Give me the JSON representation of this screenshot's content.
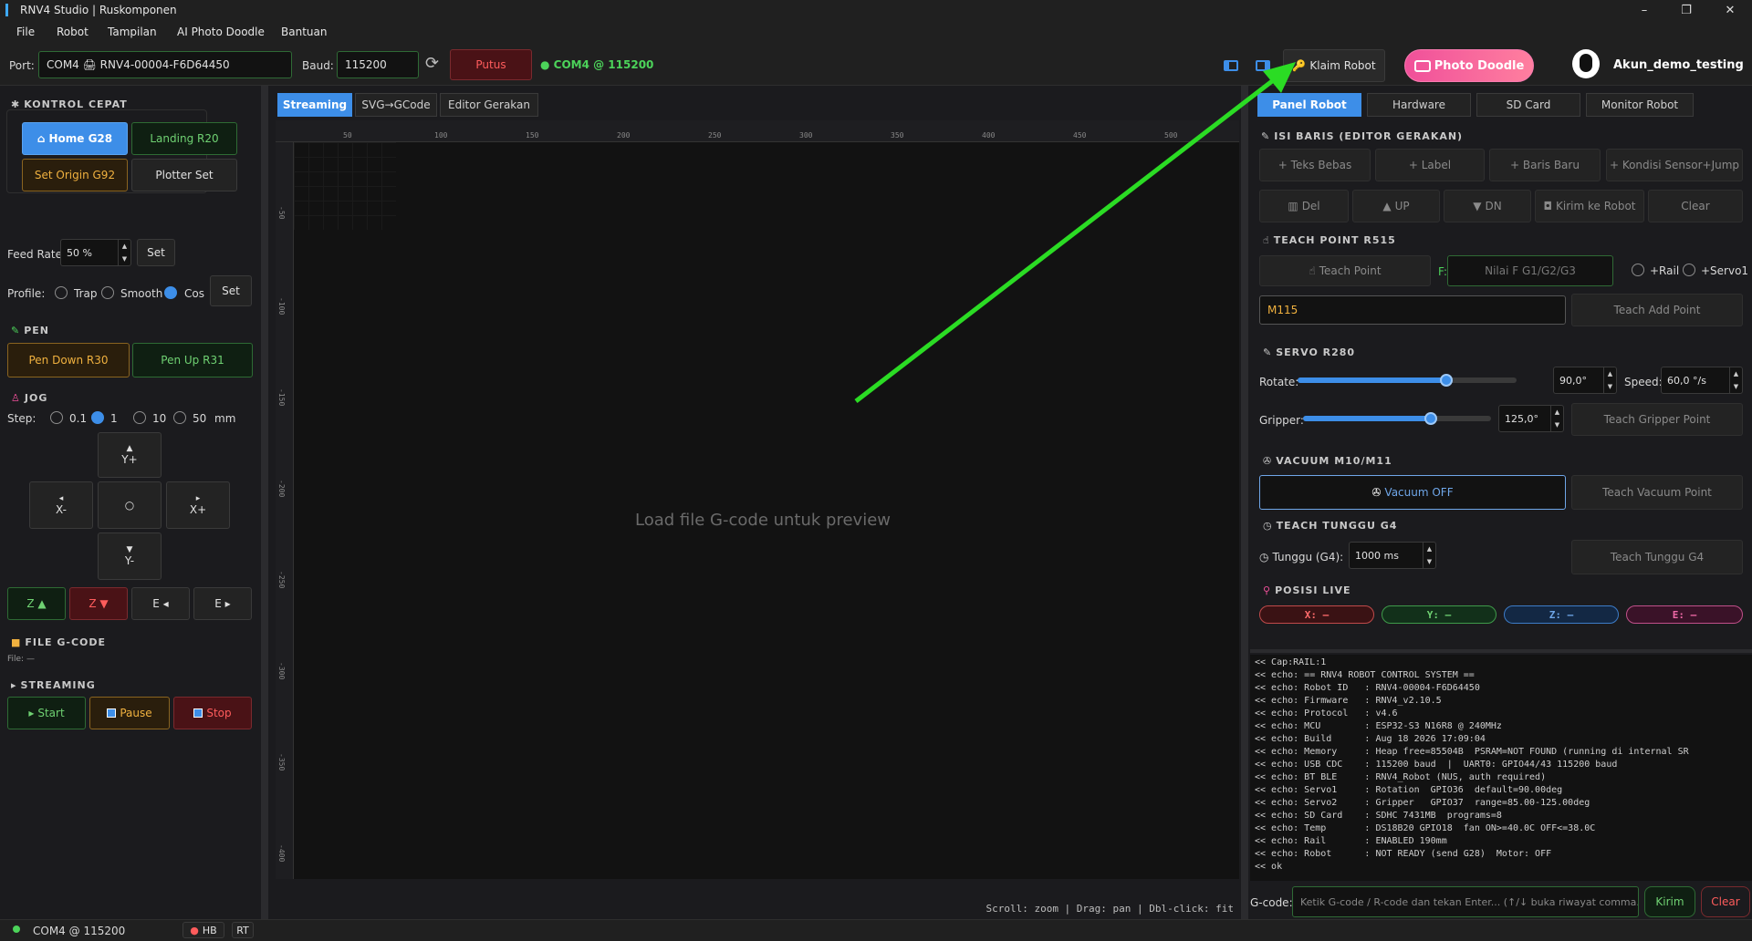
{
  "window": {
    "title": "RNV4 Studio | Ruskomponen",
    "minimize": "–",
    "maximize": "❐",
    "close": "✕"
  },
  "menu": [
    "File",
    "Robot",
    "Tampilan",
    "AI Photo Doodle",
    "Bantuan"
  ],
  "toolbar": {
    "port_label": "Port:",
    "port_value": "COM4 🖨 RNV4-00004-F6D64450",
    "baud_label": "Baud:",
    "baud_value": "115200",
    "disconnect": "Putus",
    "status": "COM4 @ 115200",
    "claim_robot": "Klaim Robot",
    "photo_doodle": "Photo Doodle",
    "account": "Akun_demo_testing"
  },
  "left": {
    "kontrol_title": "KONTROL CEPAT",
    "home": "Home  G28",
    "landing": "Landing  R20",
    "set_origin": "Set Origin  G92",
    "plotter_set": "Plotter Set",
    "feed_label": "Feed Rate:",
    "feed_value": "50 %",
    "set": "Set",
    "profile_label": "Profile:",
    "profiles": [
      "Trap",
      "Smooth",
      "Cos"
    ],
    "profile_selected": "Cos",
    "pen_title": "PEN",
    "pen_down": "Pen Down  R30",
    "pen_up": "Pen Up  R31",
    "jog_title": "JOG",
    "step_label": "Step:",
    "steps": [
      "0.1",
      "1",
      "10",
      "50"
    ],
    "step_selected": "1",
    "step_unit": "mm",
    "jog": {
      "yplus": "Y+",
      "yminus": "Y-",
      "xminus": "X-",
      "xplus": "X+",
      "center": "○"
    },
    "z_up": "Z ▲",
    "z_down": "Z ▼",
    "e_left": "E ◂",
    "e_right": "E ▸",
    "file_title": "FILE G-CODE",
    "file_info": "File: —",
    "streaming_title": "STREAMING",
    "start": "Start",
    "pause": "Pause",
    "stop": "Stop"
  },
  "center": {
    "tabs": [
      "Streaming",
      "SVG→GCode",
      "Editor Gerakan"
    ],
    "active_tab": "Streaming",
    "hticks": [
      "50",
      "100",
      "150",
      "200",
      "250",
      "300",
      "350",
      "400",
      "450",
      "500"
    ],
    "vticks": [
      "-50",
      "-100",
      "-150",
      "-200",
      "-250",
      "-300",
      "-350",
      "-400"
    ],
    "placeholder": "Load file G-code untuk preview",
    "hint": "Scroll: zoom   |   Drag: pan   |   Dbl-click: fit"
  },
  "right": {
    "tabs": [
      "Panel Robot",
      "Hardware",
      "SD Card",
      "Monitor Robot"
    ],
    "active_tab": "Panel Robot",
    "isi_title": "ISI BARIS  (EDITOR GERAKAN)",
    "isi_buttons": [
      "+ Teks Bebas",
      "+ Label",
      "+ Baris Baru",
      "+ Kondisi Sensor+Jump"
    ],
    "edit_buttons": [
      "Del",
      "UP",
      "DN",
      "Kirim ke Robot",
      "Clear"
    ],
    "teach_title": "TEACH POINT  R515",
    "teach_point": "Teach Point",
    "f_label": "F:",
    "f_placeholder": "Nilai F G1/G2/G3",
    "rail": "+Rail",
    "servo1": "+Servo1",
    "m115": "M115",
    "teach_add": "Teach Add Point",
    "servo_title": "SERVO  R280",
    "rotate_label": "Rotate:",
    "rotate_value": "90,0°",
    "rotate_fraction": 0.68,
    "speed_label": "Speed:",
    "speed_value": "60,0 °/s",
    "gripper_label": "Gripper:",
    "gripper_value": "125,0°",
    "gripper_fraction": 0.68,
    "teach_gripper": "Teach Gripper Point",
    "vacuum_title": "VACUUM  M10/M11",
    "vacuum_off": "Vacuum OFF",
    "teach_vacuum": "Teach Vacuum Point",
    "tunggu_title": "TEACH TUNGGU  G4",
    "tunggu_label": "Tunggu (G4):",
    "tunggu_value": "1000 ms",
    "teach_tunggu": "Teach Tunggu G4",
    "posisi_title": "POSISI LIVE",
    "pos": {
      "x": "X: —",
      "y": "Y: —",
      "z": "Z: —",
      "e": "E: —"
    }
  },
  "console": [
    "<< Cap:RAIL:1",
    "<< echo: == RNV4 ROBOT CONTROL SYSTEM ==",
    "<< echo: Robot ID   : RNV4-00004-F6D64450",
    "<< echo: Firmware   : RNV4_v2.10.5",
    "<< echo: Protocol   : v4.6",
    "<< echo: MCU        : ESP32-S3 N16R8 @ 240MHz",
    "<< echo: Build      : Aug 18 2026 17:09:04",
    "<< echo: Memory     : Heap free=85504B  PSRAM=NOT FOUND (running di internal SR",
    "<< echo: USB CDC    : 115200 baud  |  UART0: GPIO44/43 115200 baud",
    "<< echo: BT BLE     : RNV4_Robot (NUS, auth required)",
    "<< echo: Servo1     : Rotation  GPIO36  default=90.00deg",
    "<< echo: Servo2     : Gripper   GPIO37  range=85.00-125.00deg",
    "<< echo: SD Card    : SDHC 7431MB  programs=8",
    "<< echo: Temp       : DS18B20 GPIO18  fan ON>=40.0C OFF<=38.0C",
    "<< echo: Rail       : ENABLED 190mm",
    "<< echo: Robot      : NOT READY (send G28)  Motor: OFF",
    "<< ok"
  ],
  "gcode": {
    "label": "G-code:",
    "placeholder": "Ketik G-code / R-code dan tekan Enter... (↑/↓ buka riwayat comma...",
    "send": "Kirim",
    "clear": "Clear"
  },
  "status": {
    "conn": "COM4  @  115200",
    "hb": "HB",
    "rt": "RT"
  },
  "colors": {
    "accent": "#3d8ee8",
    "green": "#4cd35a",
    "red": "#ff5c5c",
    "orange": "#f0b13f",
    "pink": "#f0509a"
  }
}
